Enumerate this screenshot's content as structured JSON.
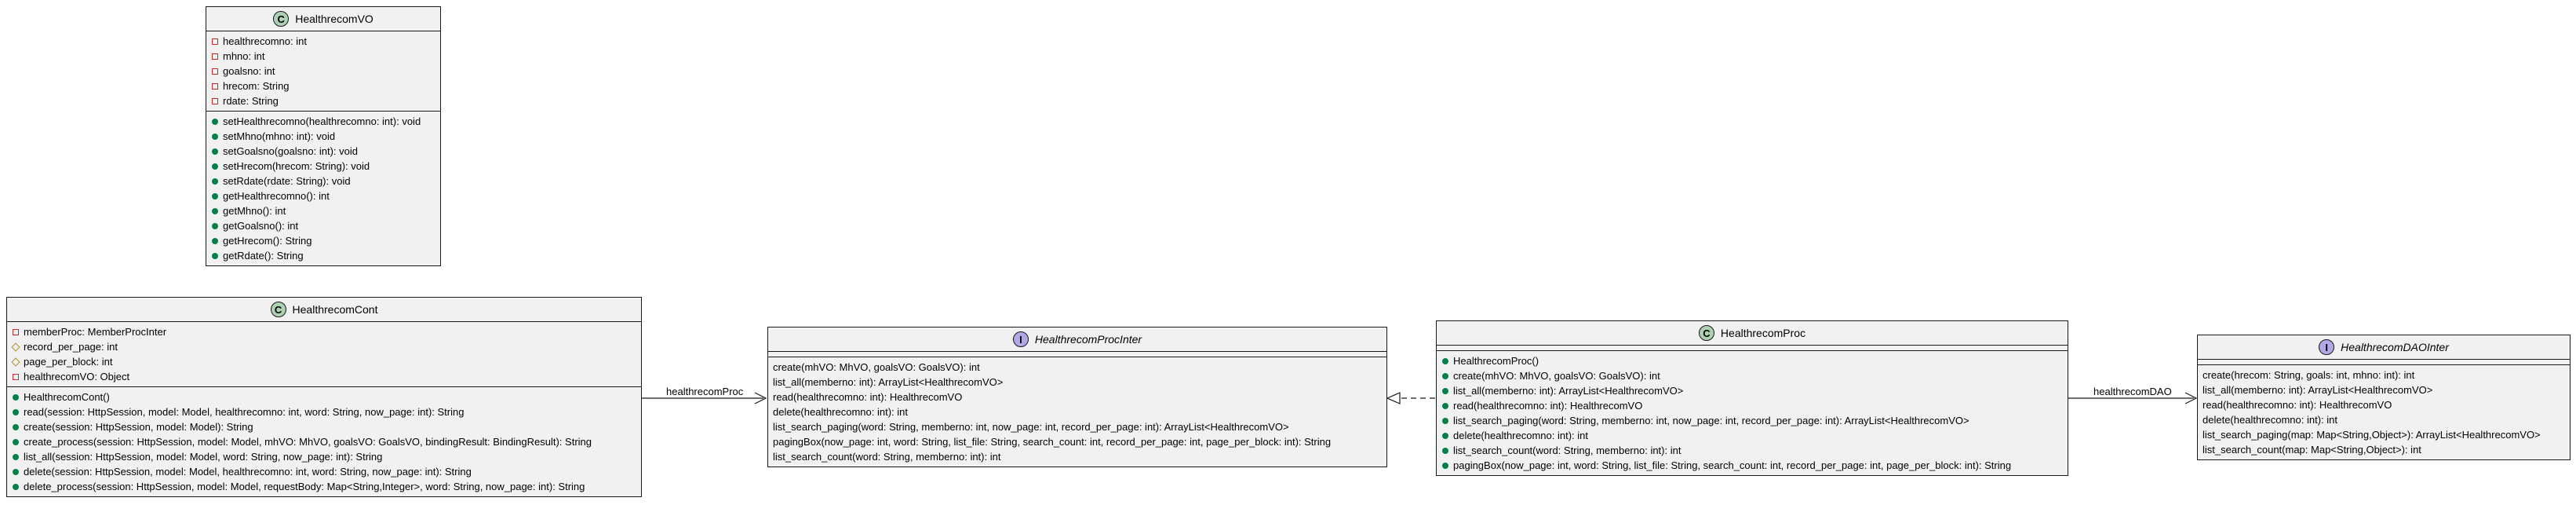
{
  "classes": {
    "vo": {
      "name": "HealthrecomVO",
      "fields": [
        {
          "vis": "private",
          "text": "healthrecomno: int"
        },
        {
          "vis": "private",
          "text": "mhno: int"
        },
        {
          "vis": "private",
          "text": "goalsno: int"
        },
        {
          "vis": "private",
          "text": "hrecom: String"
        },
        {
          "vis": "private",
          "text": "rdate: String"
        }
      ],
      "methods": [
        {
          "vis": "public",
          "text": "setHealthrecomno(healthrecomno: int): void"
        },
        {
          "vis": "public",
          "text": "setMhno(mhno: int): void"
        },
        {
          "vis": "public",
          "text": "setGoalsno(goalsno: int): void"
        },
        {
          "vis": "public",
          "text": "setHrecom(hrecom: String): void"
        },
        {
          "vis": "public",
          "text": "setRdate(rdate: String): void"
        },
        {
          "vis": "public",
          "text": "getHealthrecomno(): int"
        },
        {
          "vis": "public",
          "text": "getMhno(): int"
        },
        {
          "vis": "public",
          "text": "getGoalsno(): int"
        },
        {
          "vis": "public",
          "text": "getHrecom(): String"
        },
        {
          "vis": "public",
          "text": "getRdate(): String"
        }
      ]
    },
    "cont": {
      "name": "HealthrecomCont",
      "fields": [
        {
          "vis": "private",
          "text": "memberProc: MemberProcInter"
        },
        {
          "vis": "protected",
          "text": "record_per_page: int"
        },
        {
          "vis": "protected",
          "text": "page_per_block: int"
        },
        {
          "vis": "private",
          "text": "healthrecomVO: Object"
        }
      ],
      "methods": [
        {
          "vis": "public",
          "text": "HealthrecomCont()"
        },
        {
          "vis": "public",
          "text": "read(session: HttpSession, model: Model, healthrecomno: int, word: String, now_page: int): String"
        },
        {
          "vis": "public",
          "text": "create(session: HttpSession, model: Model): String"
        },
        {
          "vis": "public",
          "text": "create_process(session: HttpSession, model: Model, mhVO: MhVO, goalsVO: GoalsVO, bindingResult: BindingResult): String"
        },
        {
          "vis": "public",
          "text": "list_all(session: HttpSession, model: Model, word: String, now_page: int): String"
        },
        {
          "vis": "public",
          "text": "delete(session: HttpSession, model: Model, healthrecomno: int, word: String, now_page: int): String"
        },
        {
          "vis": "public",
          "text": "delete_process(session: HttpSession, model: Model, requestBody: Map<String,Integer>, word: String, now_page: int): String"
        }
      ]
    },
    "procinter": {
      "name": "HealthrecomProcInter",
      "methods": [
        {
          "text": "create(mhVO: MhVO, goalsVO: GoalsVO): int"
        },
        {
          "text": "list_all(memberno: int): ArrayList<HealthrecomVO>"
        },
        {
          "text": "read(healthrecomno: int): HealthrecomVO"
        },
        {
          "text": "delete(healthrecomno: int): int"
        },
        {
          "text": "list_search_paging(word: String, memberno: int, now_page: int, record_per_page: int): ArrayList<HealthrecomVO>"
        },
        {
          "text": "pagingBox(now_page: int, word: String, list_file: String, search_count: int, record_per_page: int, page_per_block: int): String"
        },
        {
          "text": "list_search_count(word: String, memberno: int): int"
        }
      ]
    },
    "proc": {
      "name": "HealthrecomProc",
      "methods": [
        {
          "vis": "public",
          "text": "HealthrecomProc()"
        },
        {
          "vis": "public",
          "text": "create(mhVO: MhVO, goalsVO: GoalsVO): int"
        },
        {
          "vis": "public",
          "text": "list_all(memberno: int): ArrayList<HealthrecomVO>"
        },
        {
          "vis": "public",
          "text": "read(healthrecomno: int): HealthrecomVO"
        },
        {
          "vis": "public",
          "text": "list_search_paging(word: String, memberno: int, now_page: int, record_per_page: int): ArrayList<HealthrecomVO>"
        },
        {
          "vis": "public",
          "text": "delete(healthrecomno: int): int"
        },
        {
          "vis": "public",
          "text": "list_search_count(word: String, memberno: int): int"
        },
        {
          "vis": "public",
          "text": "pagingBox(now_page: int, word: String, list_file: String, search_count: int, record_per_page: int, page_per_block: int): String"
        }
      ]
    },
    "daointer": {
      "name": "HealthrecomDAOInter",
      "methods": [
        {
          "text": "create(hrecom: String, goals: int, mhno: int): int"
        },
        {
          "text": "list_all(memberno: int): ArrayList<HealthrecomVO>"
        },
        {
          "text": "read(healthrecomno: int): HealthrecomVO"
        },
        {
          "text": "delete(healthrecomno: int): int"
        },
        {
          "text": "list_search_paging(map: Map<String,Object>): ArrayList<HealthrecomVO>"
        },
        {
          "text": "list_search_count(map: Map<String,Object>): int"
        }
      ]
    }
  },
  "badges": {
    "class": "C",
    "interface": "I"
  },
  "edges": {
    "cont_to_procinter": "healthrecomProc",
    "proc_to_daointer": "healthrecomDAO"
  },
  "colors": {
    "class_fill": "#f1f1f1",
    "border": "#181818",
    "class_badge": "#add1b2",
    "interface_badge": "#b4a7e5",
    "private": "#c82930",
    "protected": "#b38d22",
    "public": "#038048"
  }
}
